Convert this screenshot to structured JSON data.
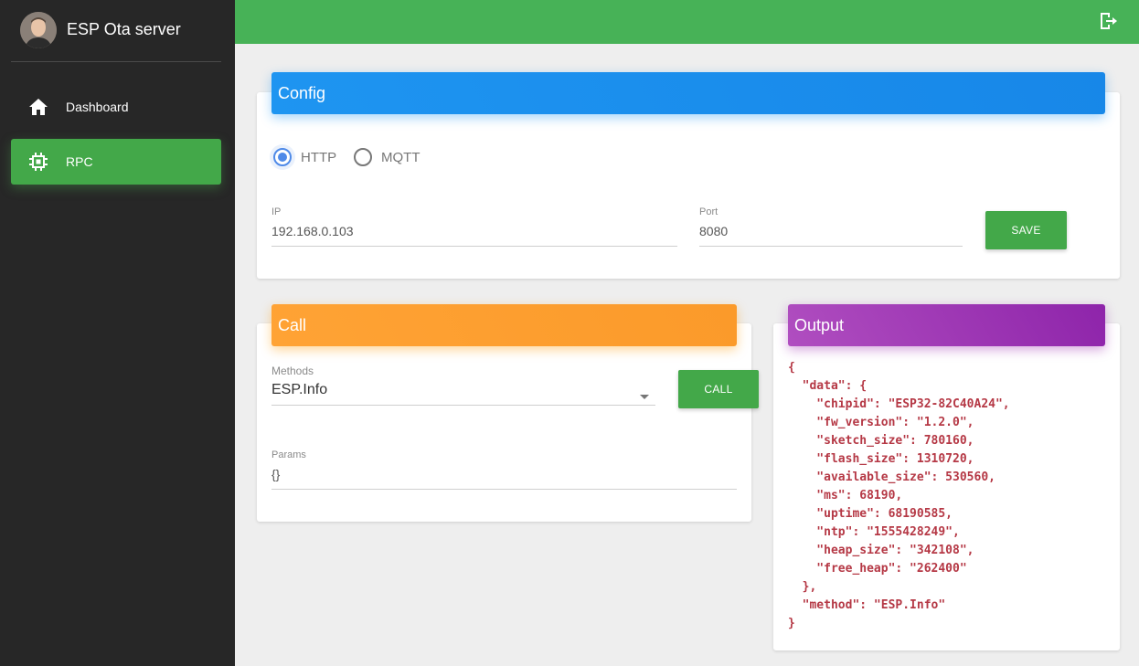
{
  "app": {
    "title": "ESP Ota server"
  },
  "sidebar": {
    "items": [
      {
        "label": "Dashboard",
        "icon": "home-icon"
      },
      {
        "label": "RPC",
        "icon": "chip-icon",
        "active": true
      }
    ]
  },
  "topbar": {
    "icon": "logout-icon"
  },
  "config": {
    "title": "Config",
    "protocols": [
      {
        "label": "HTTP",
        "selected": true
      },
      {
        "label": "MQTT",
        "selected": false
      }
    ],
    "ip_label": "IP",
    "ip_value": "192.168.0.103",
    "port_label": "Port",
    "port_value": "8080",
    "save_label": "SAVE"
  },
  "call": {
    "title": "Call",
    "methods_label": "Methods",
    "methods_value": "ESP.Info",
    "call_label": "CALL",
    "params_label": "Params",
    "params_value": "{}"
  },
  "output": {
    "title": "Output",
    "text": "{\n  \"data\": {\n    \"chipid\": \"ESP32-82C40A24\",\n    \"fw_version\": \"1.2.0\",\n    \"sketch_size\": 780160,\n    \"flash_size\": 1310720,\n    \"available_size\": 530560,\n    \"ms\": 68190,\n    \"uptime\": 68190585,\n    \"ntp\": \"1555428249\",\n    \"heap_size\": \"342108\",\n    \"free_heap\": \"262400\"\n  },\n  \"method\": \"ESP.Info\"\n}"
  },
  "colors": {
    "sidebar_bg": "#272727",
    "accent_green": "#47b257",
    "config_header": "#1e95f1",
    "call_header": "#ffa335",
    "output_header": "#9c27b0",
    "json_text": "#b53845"
  }
}
